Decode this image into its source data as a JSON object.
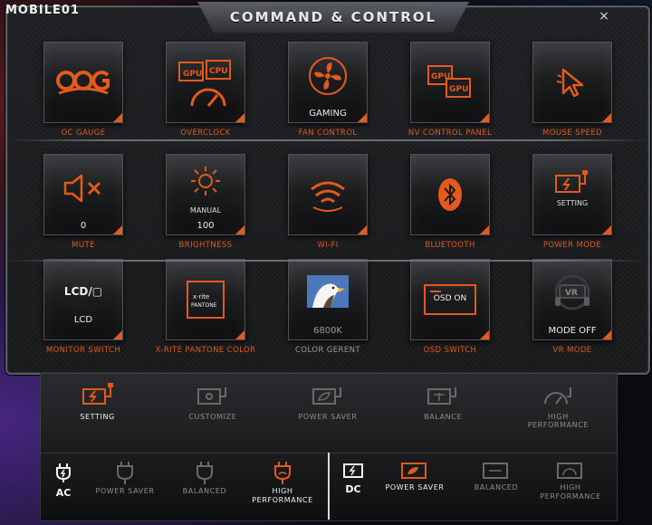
{
  "window": {
    "title": "COMMAND & CONTROL",
    "watermark": "MOBILE01",
    "close_glyph": "×"
  },
  "colors": {
    "accent": "#e25a1c",
    "tile_top": "#3a3b3e",
    "tile_bottom": "#0e0e10",
    "label_dim": "#9a9a9a"
  },
  "tiles": [
    {
      "label": "OC GAUGE",
      "icon": "oc-gauge-icon",
      "value": "",
      "sub": ""
    },
    {
      "label": "OVERCLOCK",
      "icon": "gpu-cpu-icon",
      "value": "",
      "sub": ""
    },
    {
      "label": "FAN CONTROL",
      "icon": "fan-icon",
      "value": "GAMING",
      "sub": ""
    },
    {
      "label": "NV CONTROL PANEL",
      "icon": "dual-gpu-icon",
      "value": "",
      "sub": ""
    },
    {
      "label": "MOUSE SPEED",
      "icon": "mouse-cursor-icon",
      "value": "",
      "sub": ""
    },
    {
      "label": "MUTE",
      "icon": "speaker-mute-icon",
      "value": "0",
      "sub": ""
    },
    {
      "label": "BRIGHTNESS",
      "icon": "sun-icon",
      "value": "100",
      "sub": "MANUAL"
    },
    {
      "label": "WI-FI",
      "icon": "wifi-icon",
      "value": "",
      "sub": ""
    },
    {
      "label": "BLUETOOTH",
      "icon": "bluetooth-icon",
      "value": "",
      "sub": ""
    },
    {
      "label": "POWER MODE",
      "icon": "battery-plug-icon",
      "value": "",
      "sub": "SETTING"
    },
    {
      "label": "MONITOR SWITCH",
      "icon": "lcd-monitor-icon",
      "value": "LCD",
      "sub": "LCD/▢"
    },
    {
      "label": "X-RITE PANTONE COLOR",
      "icon": "xrite-pantone-icon",
      "value": "",
      "sub": ""
    },
    {
      "label": "COLOR GERENT",
      "icon": "eagle-image-icon",
      "value": "6800K",
      "sub": ""
    },
    {
      "label": "OSD SWITCH",
      "icon": "osd-on-icon",
      "value": "",
      "sub": "OSD ON"
    },
    {
      "label": "VR MODE",
      "icon": "vr-headset-icon",
      "value": "MODE OFF",
      "sub": ""
    }
  ],
  "power_modes": [
    {
      "label": "SETTING",
      "icon": "battery-plug-icon",
      "active": true
    },
    {
      "label": "CUSTOMIZE",
      "icon": "battery-gear-icon",
      "active": false
    },
    {
      "label": "POWER SAVER",
      "icon": "battery-leaf-icon",
      "active": false
    },
    {
      "label": "BALANCE",
      "icon": "battery-balance-icon",
      "active": false
    },
    {
      "label": "HIGH\nPERFORMANCE",
      "icon": "battery-speed-icon",
      "active": false
    }
  ],
  "ac": {
    "label": "AC",
    "modes": [
      {
        "label": "POWER SAVER",
        "active": false
      },
      {
        "label": "BALANCED",
        "active": false
      },
      {
        "label": "HIGH\nPERFORMANCE",
        "active": true
      }
    ]
  },
  "dc": {
    "label": "DC",
    "modes": [
      {
        "label": "POWER SAVER",
        "active": true
      },
      {
        "label": "BALANCED",
        "active": false
      },
      {
        "label": "HIGH\nPERFORMANCE",
        "active": false
      }
    ]
  }
}
